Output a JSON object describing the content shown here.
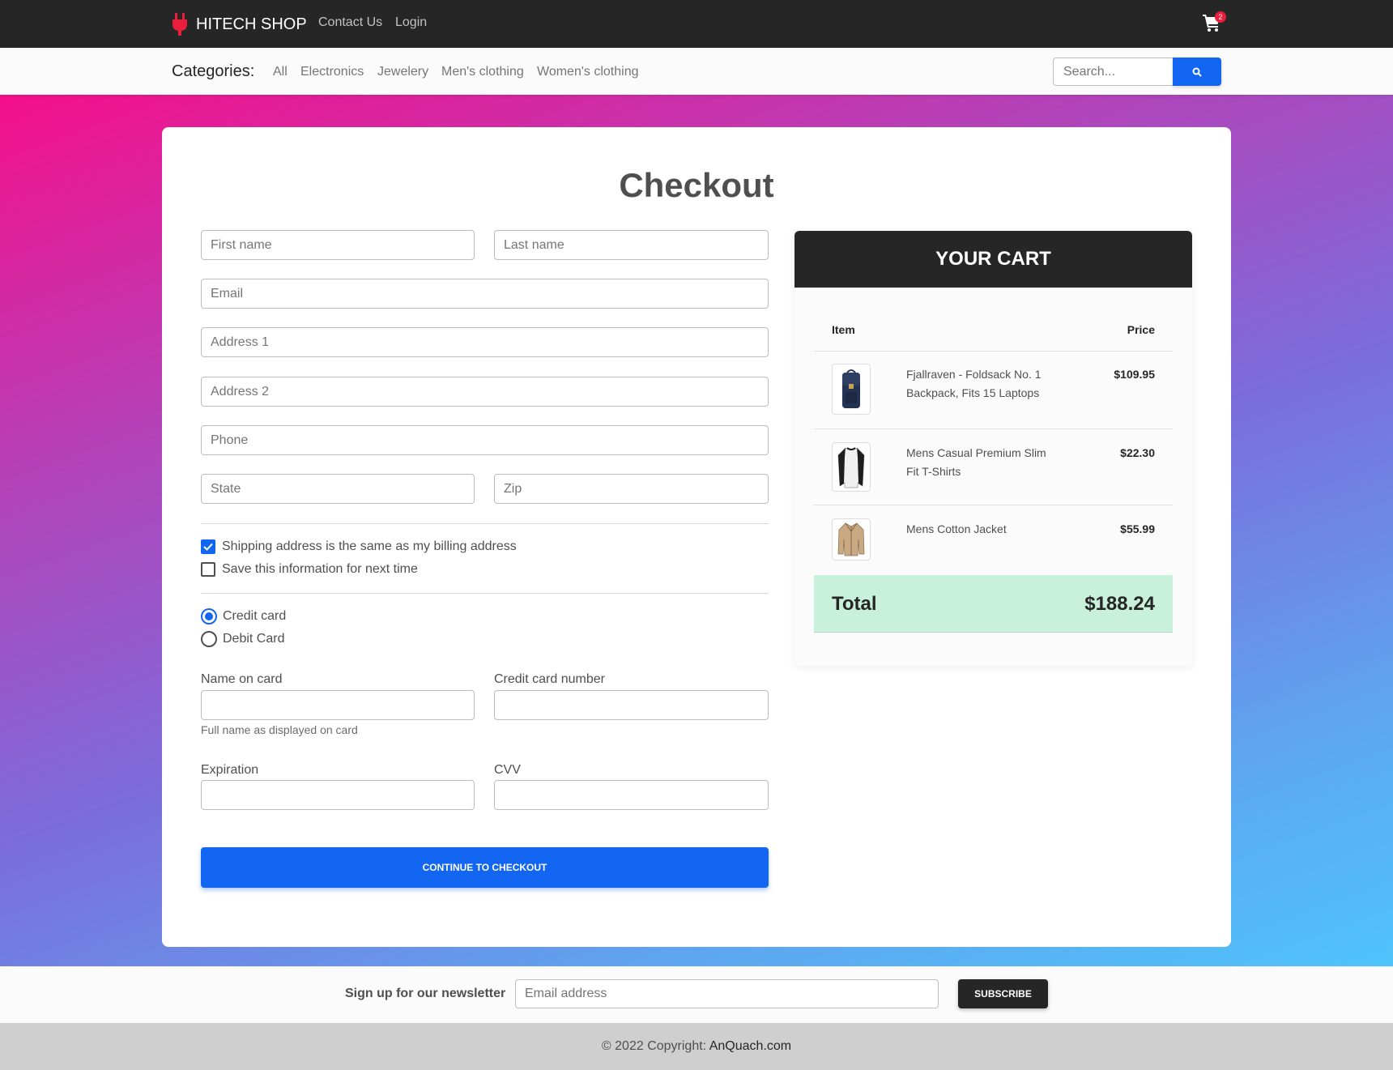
{
  "navbar": {
    "brand": "HITECH SHOP",
    "links": [
      "Contact Us",
      "Login"
    ],
    "cart_count": "2",
    "brand_icon_color": "#e91e3c"
  },
  "categories": {
    "title": "Categories:",
    "items": [
      "All",
      "Electronics",
      "Jewelery",
      "Men's clothing",
      "Women's clothing"
    ],
    "search_placeholder": "Search..."
  },
  "checkout": {
    "title": "Checkout",
    "placeholders": {
      "first_name": "First name",
      "last_name": "Last name",
      "email": "Email",
      "address1": "Address 1",
      "address2": "Address 2",
      "phone": "Phone",
      "state": "State",
      "zip": "Zip"
    },
    "options": {
      "same_address": {
        "label": "Shipping address is the same as my billing address",
        "checked": true
      },
      "save_info": {
        "label": "Save this information for next time",
        "checked": false
      }
    },
    "payment": {
      "methods": [
        "Credit card",
        "Debit Card"
      ],
      "selected": "Credit card"
    },
    "card": {
      "name_label": "Name on card",
      "name_help": "Full name as displayed on card",
      "number_label": "Credit card number",
      "expiration_label": "Expiration",
      "cvv_label": "CVV"
    },
    "continue_label": "CONTINUE TO CHECKOUT"
  },
  "cart": {
    "title": "YOUR CART",
    "col_item": "Item",
    "col_price": "Price",
    "items": [
      {
        "name": "Fjallraven - Foldsack No. 1 Backpack, Fits 15 Laptops",
        "price": "$109.95",
        "icon": "backpack-icon"
      },
      {
        "name": "Mens Casual Premium Slim Fit T-Shirts",
        "price": "$22.30",
        "icon": "tshirt-icon"
      },
      {
        "name": "Mens Cotton Jacket",
        "price": "$55.99",
        "icon": "jacket-icon"
      }
    ],
    "total_label": "Total",
    "total_value": "$188.24"
  },
  "newsletter": {
    "label": "Sign up for our newsletter",
    "placeholder": "Email address",
    "button": "SUBSCRIBE"
  },
  "footer": {
    "text": "© 2022 Copyright: ",
    "link": "AnQuach.com"
  },
  "colors": {
    "primary": "#1266f1",
    "dark": "#262626",
    "total_bg": "#c9f0db"
  }
}
